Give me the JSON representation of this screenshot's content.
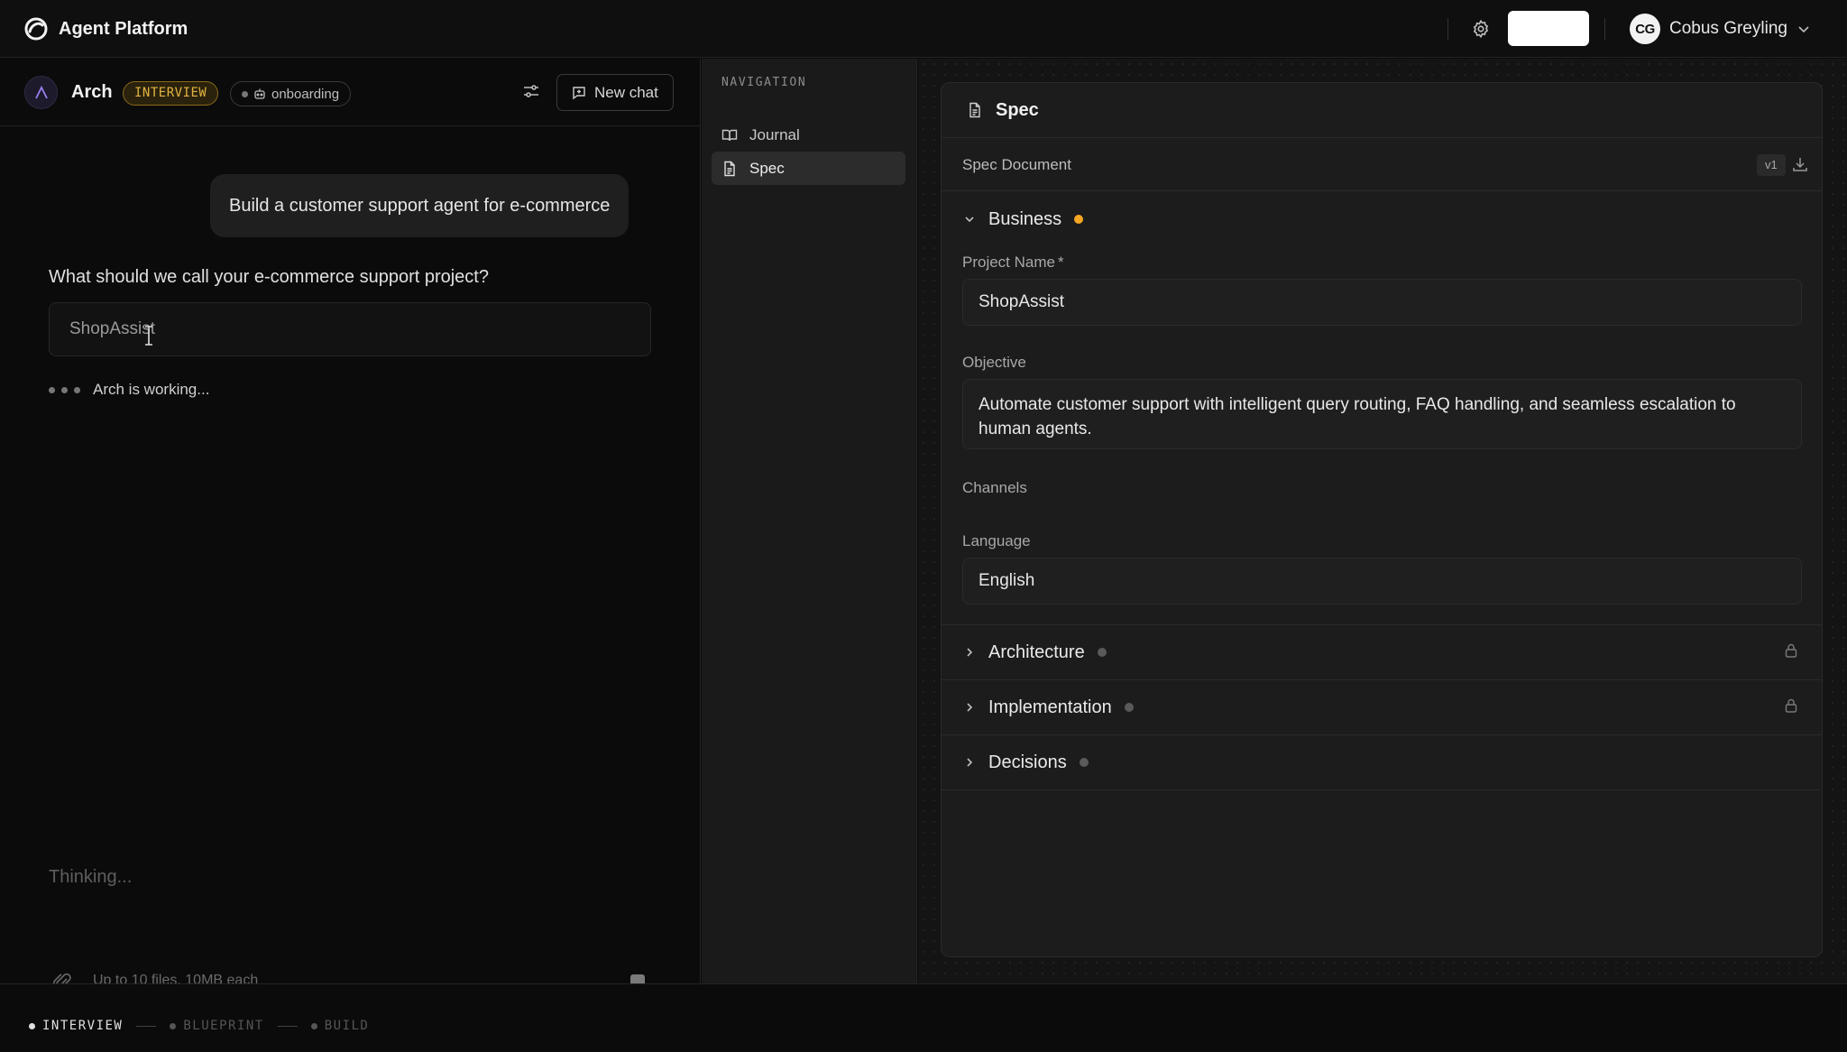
{
  "app": {
    "title": "Agent Platform"
  },
  "user": {
    "initials": "CG",
    "name": "Cobus Greyling"
  },
  "chat": {
    "agent_name": "Arch",
    "phase_badge": "INTERVIEW",
    "mode_badge": "onboarding",
    "new_chat_label": "New chat",
    "user_message": "Build a customer support agent for e-commerce",
    "question": "What should we call your e-commerce support project?",
    "answer_value": "ShopAssist",
    "status_text": "Arch is working...",
    "composer_placeholder": "Thinking...",
    "attach_note": "Up to 10 files, 10MB each"
  },
  "navigation": {
    "title": "NAVIGATION",
    "items": [
      {
        "label": "Journal",
        "icon": "book-icon",
        "active": false
      },
      {
        "label": "Spec",
        "icon": "document-icon",
        "active": true
      }
    ]
  },
  "spec": {
    "header_title": "Spec",
    "document_title": "Spec Document",
    "version": "v1",
    "sections": [
      {
        "title": "Business",
        "status_color": "#f5a623",
        "expanded": true,
        "locked": false
      },
      {
        "title": "Architecture",
        "status_color": "#5a5a5a",
        "expanded": false,
        "locked": true
      },
      {
        "title": "Implementation",
        "status_color": "#5a5a5a",
        "expanded": false,
        "locked": true
      },
      {
        "title": "Decisions",
        "status_color": "#5a5a5a",
        "expanded": false,
        "locked": false
      }
    ],
    "business": {
      "project_name_label": "Project Name",
      "required_mark": "*",
      "project_name_value": "ShopAssist",
      "objective_label": "Objective",
      "objective_value": "Automate customer support with intelligent query routing, FAQ handling, and seamless escalation to human agents.",
      "channels_label": "Channels",
      "language_label": "Language",
      "language_value": "English"
    }
  },
  "stepper": {
    "steps": [
      {
        "label": "INTERVIEW",
        "active": true
      },
      {
        "label": "BLUEPRINT",
        "active": false
      },
      {
        "label": "BUILD",
        "active": false
      }
    ]
  },
  "colors": {
    "accent_orange": "#f5a623",
    "badge_gold": "#e3b341",
    "background": "#0b0b0b",
    "panel": "#1c1c1c"
  }
}
